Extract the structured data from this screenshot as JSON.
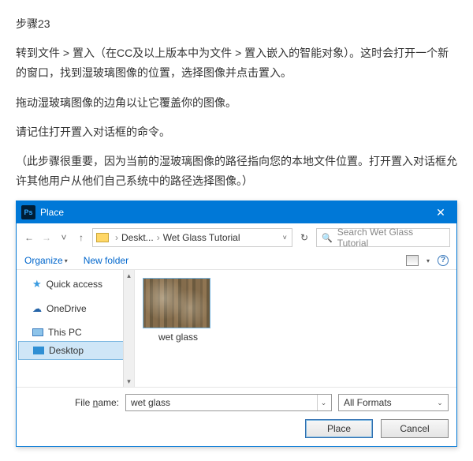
{
  "instructions": {
    "step_title": "步骤23",
    "p1": "转到文件 > 置入（在CC及以上版本中为文件 > 置入嵌入的智能对象）。这时会打开一个新的窗口，找到湿玻璃图像的位置，选择图像并点击置入。",
    "p2": "拖动湿玻璃图像的边角以让它覆盖你的图像。",
    "p3": "请记住打开置入对话框的命令。",
    "p4": "（此步骤很重要，因为当前的湿玻璃图像的路径指向您的本地文件位置。打开置入对话框允许其他用户从他们自己系统中的路径选择图像。）"
  },
  "dialog": {
    "app_icon_text": "Ps",
    "title": "Place",
    "close": "✕",
    "nav": {
      "back": "←",
      "fwd": "→",
      "up": "↑",
      "dd": "˅"
    },
    "crumbs": {
      "c1": "Deskt...",
      "sep": "›",
      "c2": "Wet Glass Tutorial"
    },
    "refresh": "↻",
    "search_placeholder": "Search Wet Glass Tutorial",
    "toolbar": {
      "organize": "Organize",
      "dropdown": "▾",
      "new_folder": "New folder",
      "help": "?"
    },
    "sidebar": {
      "items": [
        {
          "label": "Quick access"
        },
        {
          "label": "OneDrive"
        },
        {
          "label": "This PC"
        },
        {
          "label": "Desktop"
        }
      ]
    },
    "file": {
      "name": "wet glass"
    },
    "bottom": {
      "filename_label_pre": "File ",
      "filename_label_u": "n",
      "filename_label_post": "ame:",
      "filename_value": "wet glass",
      "filter": "All Formats",
      "place": "Place",
      "cancel": "Cancel"
    }
  }
}
